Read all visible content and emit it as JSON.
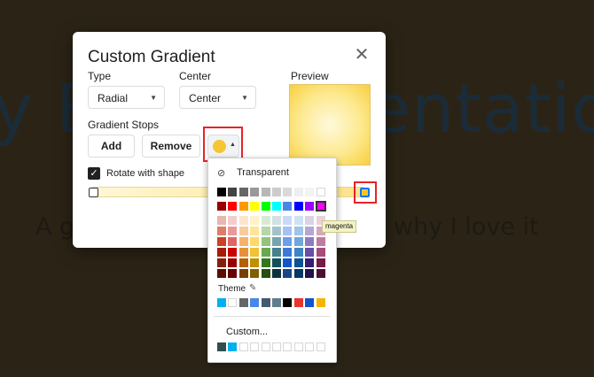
{
  "background_slide": {
    "title_fragments": [
      "y B",
      "entatio"
    ],
    "subtitle_fragments": [
      "A g",
      "why I love it"
    ]
  },
  "dialog": {
    "title": "Custom Gradient",
    "close_icon": "close-icon",
    "type_label": "Type",
    "type_value": "Radial",
    "center_label": "Center",
    "center_value": "Center",
    "preview_label": "Preview",
    "stops_label": "Gradient Stops",
    "add_label": "Add",
    "remove_label": "Remove",
    "rotate_label": "Rotate with shape",
    "rotate_checked": true,
    "selected_stop_color": "#f7c531",
    "accent_color": "#f6b400",
    "highlight_color": "#e8222b"
  },
  "palette": {
    "transparent_label": "Transparent",
    "theme_label": "Theme",
    "custom_label": "Custom...",
    "tooltip": "magenta",
    "grays": [
      "#000000",
      "#434343",
      "#666666",
      "#999999",
      "#b7b7b7",
      "#cccccc",
      "#d9d9d9",
      "#efefef",
      "#f3f3f3",
      "#ffffff"
    ],
    "brights": [
      "#980000",
      "#ff0000",
      "#ff9900",
      "#ffff00",
      "#00ff00",
      "#00ffff",
      "#4a86e8",
      "#0000ff",
      "#9900ff",
      "#ff00ff"
    ],
    "shades": [
      [
        "#e6b8af",
        "#f4cccc",
        "#fce5cd",
        "#fff2cc",
        "#d9ead3",
        "#d0e0e3",
        "#c9daf8",
        "#cfe2f3",
        "#d9d2e9",
        "#ead1dc"
      ],
      [
        "#dd7e6b",
        "#ea9999",
        "#f9cb9c",
        "#ffe599",
        "#b6d7a8",
        "#a2c4c9",
        "#a4c2f4",
        "#9fc5e8",
        "#b4a7d6",
        "#d5a6bd"
      ],
      [
        "#cc4125",
        "#e06666",
        "#f6b26b",
        "#ffd966",
        "#93c47d",
        "#76a5af",
        "#6d9eeb",
        "#6fa8dc",
        "#8e7cc3",
        "#c27ba0"
      ],
      [
        "#a61c00",
        "#cc0000",
        "#e69138",
        "#f1c232",
        "#6aa84f",
        "#45818e",
        "#3c78d8",
        "#3d85c6",
        "#674ea7",
        "#a64d79"
      ],
      [
        "#85200c",
        "#990000",
        "#b45f06",
        "#bf9000",
        "#38761d",
        "#134f5c",
        "#1155cc",
        "#0b5394",
        "#351c75",
        "#741b47"
      ],
      [
        "#5b0f00",
        "#660000",
        "#783f04",
        "#7f6000",
        "#274e13",
        "#0c343d",
        "#1c4587",
        "#073763",
        "#20124d",
        "#4c1130"
      ]
    ],
    "theme": [
      "#00b0f0",
      "#ffffff",
      "#666666",
      "#4a86e8",
      "#45586e",
      "#5f7d8e",
      "#000000",
      "#e8362b",
      "#1155cc",
      "#f6b400"
    ],
    "custom": [
      "#2f4f4f",
      "#00b0f0",
      "#ffffff",
      "#ffffff",
      "#ffffff",
      "#ffffff",
      "#ffffff",
      "#ffffff",
      "#ffffff",
      "#ffffff"
    ]
  }
}
